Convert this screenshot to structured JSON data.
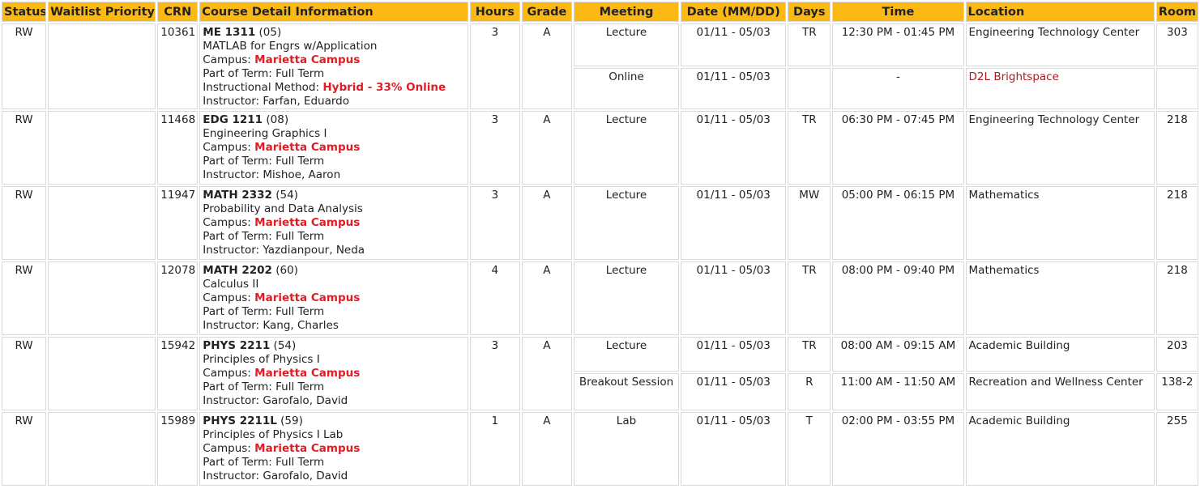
{
  "headers": {
    "status": "Status",
    "waitlist": "Waitlist Priority",
    "crn": "CRN",
    "detail": "Course Detail Information",
    "hours": "Hours",
    "grade": "Grade",
    "meeting": "Meeting",
    "date": "Date (MM/DD)",
    "days": "Days",
    "time": "Time",
    "location": "Location",
    "room": "Room"
  },
  "labels": {
    "campus": "Campus: ",
    "part_of_term": "Part of Term: ",
    "instructional_method": "Instructional Method: ",
    "instructor": "Instructor: "
  },
  "courses": [
    {
      "status": "RW",
      "waitlist": "",
      "crn": "10361",
      "code": "ME 1311",
      "section": " (05)",
      "title": "MATLAB for Engrs w/Application",
      "campus": "Marietta Campus",
      "part_of_term": "Full Term",
      "instructional_method": "Hybrid - 33% Online",
      "instructor": "Farfan, Eduardo",
      "hours": "3",
      "grade": "A",
      "meetings": [
        {
          "type": "Lecture",
          "date": "01/11 - 05/03",
          "days": "TR",
          "time": "12:30 PM - 01:45 PM",
          "location": "Engineering Technology Center",
          "room": "303"
        },
        {
          "type": "Online",
          "date": "01/11 - 05/03",
          "days": "",
          "time": "-",
          "location": "D2L Brightspace",
          "room": ""
        }
      ]
    },
    {
      "status": "RW",
      "waitlist": "",
      "crn": "11468",
      "code": "EDG 1211",
      "section": " (08)",
      "title": "Engineering Graphics I",
      "campus": "Marietta Campus",
      "part_of_term": "Full Term",
      "instructor": "Mishoe, Aaron",
      "hours": "3",
      "grade": "A",
      "meetings": [
        {
          "type": "Lecture",
          "date": "01/11 - 05/03",
          "days": "TR",
          "time": "06:30 PM - 07:45 PM",
          "location": "Engineering Technology Center",
          "room": "218"
        }
      ]
    },
    {
      "status": "RW",
      "waitlist": "",
      "crn": "11947",
      "code": "MATH 2332",
      "section": " (54)",
      "title": "Probability and Data Analysis",
      "campus": "Marietta Campus",
      "part_of_term": "Full Term",
      "instructor": "Yazdianpour, Neda",
      "hours": "3",
      "grade": "A",
      "meetings": [
        {
          "type": "Lecture",
          "date": "01/11 - 05/03",
          "days": "MW",
          "time": "05:00 PM - 06:15 PM",
          "location": "Mathematics",
          "room": "218"
        }
      ]
    },
    {
      "status": "RW",
      "waitlist": "",
      "crn": "12078",
      "code": "MATH 2202",
      "section": " (60)",
      "title": "Calculus II",
      "campus": "Marietta Campus",
      "part_of_term": "Full Term",
      "instructor": "Kang, Charles",
      "hours": "4",
      "grade": "A",
      "meetings": [
        {
          "type": "Lecture",
          "date": "01/11 - 05/03",
          "days": "TR",
          "time": "08:00 PM - 09:40 PM",
          "location": "Mathematics",
          "room": "218"
        }
      ]
    },
    {
      "status": "RW",
      "waitlist": "",
      "crn": "15942",
      "code": "PHYS 2211",
      "section": " (54)",
      "title": "Principles of Physics I",
      "campus": "Marietta Campus",
      "part_of_term": "Full Term",
      "instructor": "Garofalo, David",
      "hours": "3",
      "grade": "A",
      "meetings": [
        {
          "type": "Lecture",
          "date": "01/11 - 05/03",
          "days": "TR",
          "time": "08:00 AM - 09:15 AM",
          "location": "Academic Building",
          "room": "203"
        },
        {
          "type": "Breakout Session",
          "date": "01/11 - 05/03",
          "days": "R",
          "time": "11:00 AM - 11:50 AM",
          "location": "Recreation and Wellness Center",
          "room": "138-2"
        }
      ]
    },
    {
      "status": "RW",
      "waitlist": "",
      "crn": "15989",
      "code": "PHYS 2211L",
      "section": " (59)",
      "title": "Principles of Physics I Lab",
      "campus": "Marietta Campus",
      "part_of_term": "Full Term",
      "instructor": "Garofalo, David",
      "hours": "1",
      "grade": "A",
      "meetings": [
        {
          "type": "Lab",
          "date": "01/11 - 05/03",
          "days": "T",
          "time": "02:00 PM - 03:55 PM",
          "location": "Academic Building",
          "room": "255"
        }
      ]
    }
  ],
  "colors": {
    "header_bg": "#fcb913",
    "campus_red": "#e31b23",
    "link_maroon": "#a41e22"
  }
}
